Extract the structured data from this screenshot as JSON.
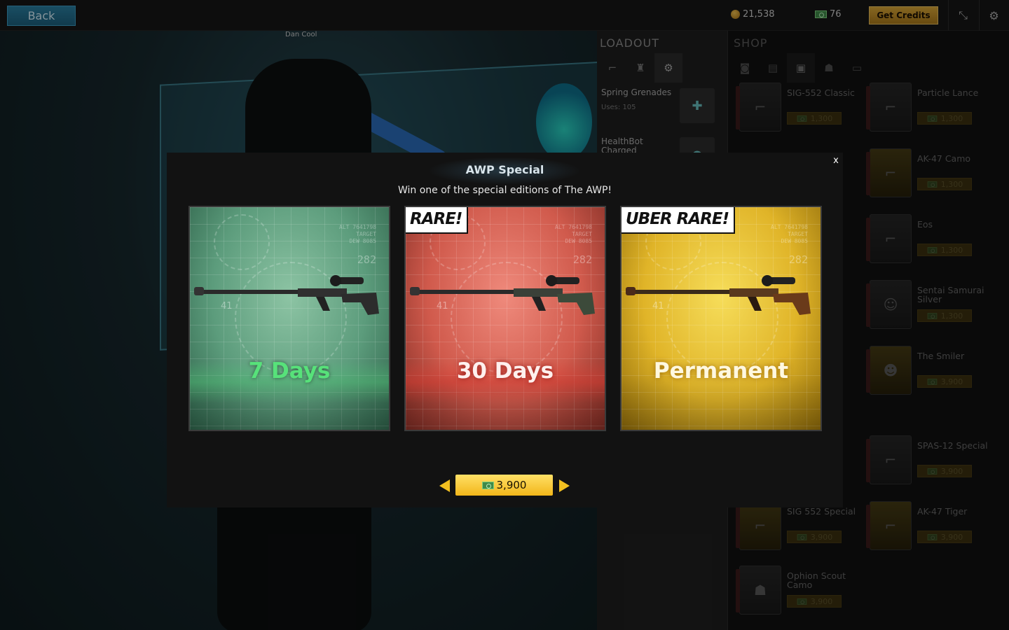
{
  "topbar": {
    "back_label": "Back",
    "coins": "21,538",
    "cash": "76",
    "get_credits_label": "Get Credits",
    "icons": [
      "collapse-icon",
      "gear-icon"
    ]
  },
  "player": {
    "name": "Dan Cool"
  },
  "loadout": {
    "title": "LOADOUT",
    "tabs": [
      "weapon-tab-icon",
      "armor-tab-icon",
      "gear-icon"
    ],
    "items": [
      {
        "name": "Spring Grenades",
        "uses": "Uses: 105"
      },
      {
        "name": "HealthBot Charged",
        "uses": ""
      }
    ]
  },
  "shop": {
    "title": "SHOP",
    "tabs": [
      "helmet-tab-icon",
      "crate-tab-icon",
      "chest-tab-icon",
      "character-tab-icon",
      "cash-tab-icon"
    ],
    "items": [
      {
        "name": "SIG-552 Classic",
        "price": "1,300"
      },
      {
        "name": "Particle Lance",
        "price": "1,300"
      },
      {
        "name": "AK-47 Camo",
        "price": "1,300"
      },
      {
        "name": "Eos",
        "price": "1,300"
      },
      {
        "name": "Sentai Samurai Silver",
        "price": "1,300"
      },
      {
        "name": "The Smiler",
        "price": "3,900"
      },
      {
        "name": "SPAS-12 Special",
        "price": "3,900"
      },
      {
        "name": "SIG 552 Special",
        "price": "3,900"
      },
      {
        "name": "AK-47 Tiger",
        "price": "3,900"
      },
      {
        "name": "Ophion Scout Camo",
        "price": "3,900"
      }
    ]
  },
  "modal": {
    "title": "AWP Special",
    "subtitle": "Win one of the special editions of The AWP!",
    "close_label": "x",
    "cards": [
      {
        "label": "7 Days",
        "tag": "",
        "color": "#5c9c7c",
        "hud_num": "41",
        "hud_num2": "282",
        "hud_text": "ALT 7641798\nTARGET\nDEW 8085"
      },
      {
        "label": "30 Days",
        "tag": "RARE!",
        "color": "#d05a4c",
        "hud_num": "41",
        "hud_num2": "282",
        "hud_text": "ALT 7641798\nTARGET\nDEW 8085"
      },
      {
        "label": "Permanent",
        "tag": "UBER RARE!",
        "color": "#e0b428",
        "hud_num": "41",
        "hud_num2": "282",
        "hud_text": "ALT 7641798\nTARGET\nDEW 8085"
      }
    ],
    "price": "3,900",
    "accent": "#f2c020"
  }
}
